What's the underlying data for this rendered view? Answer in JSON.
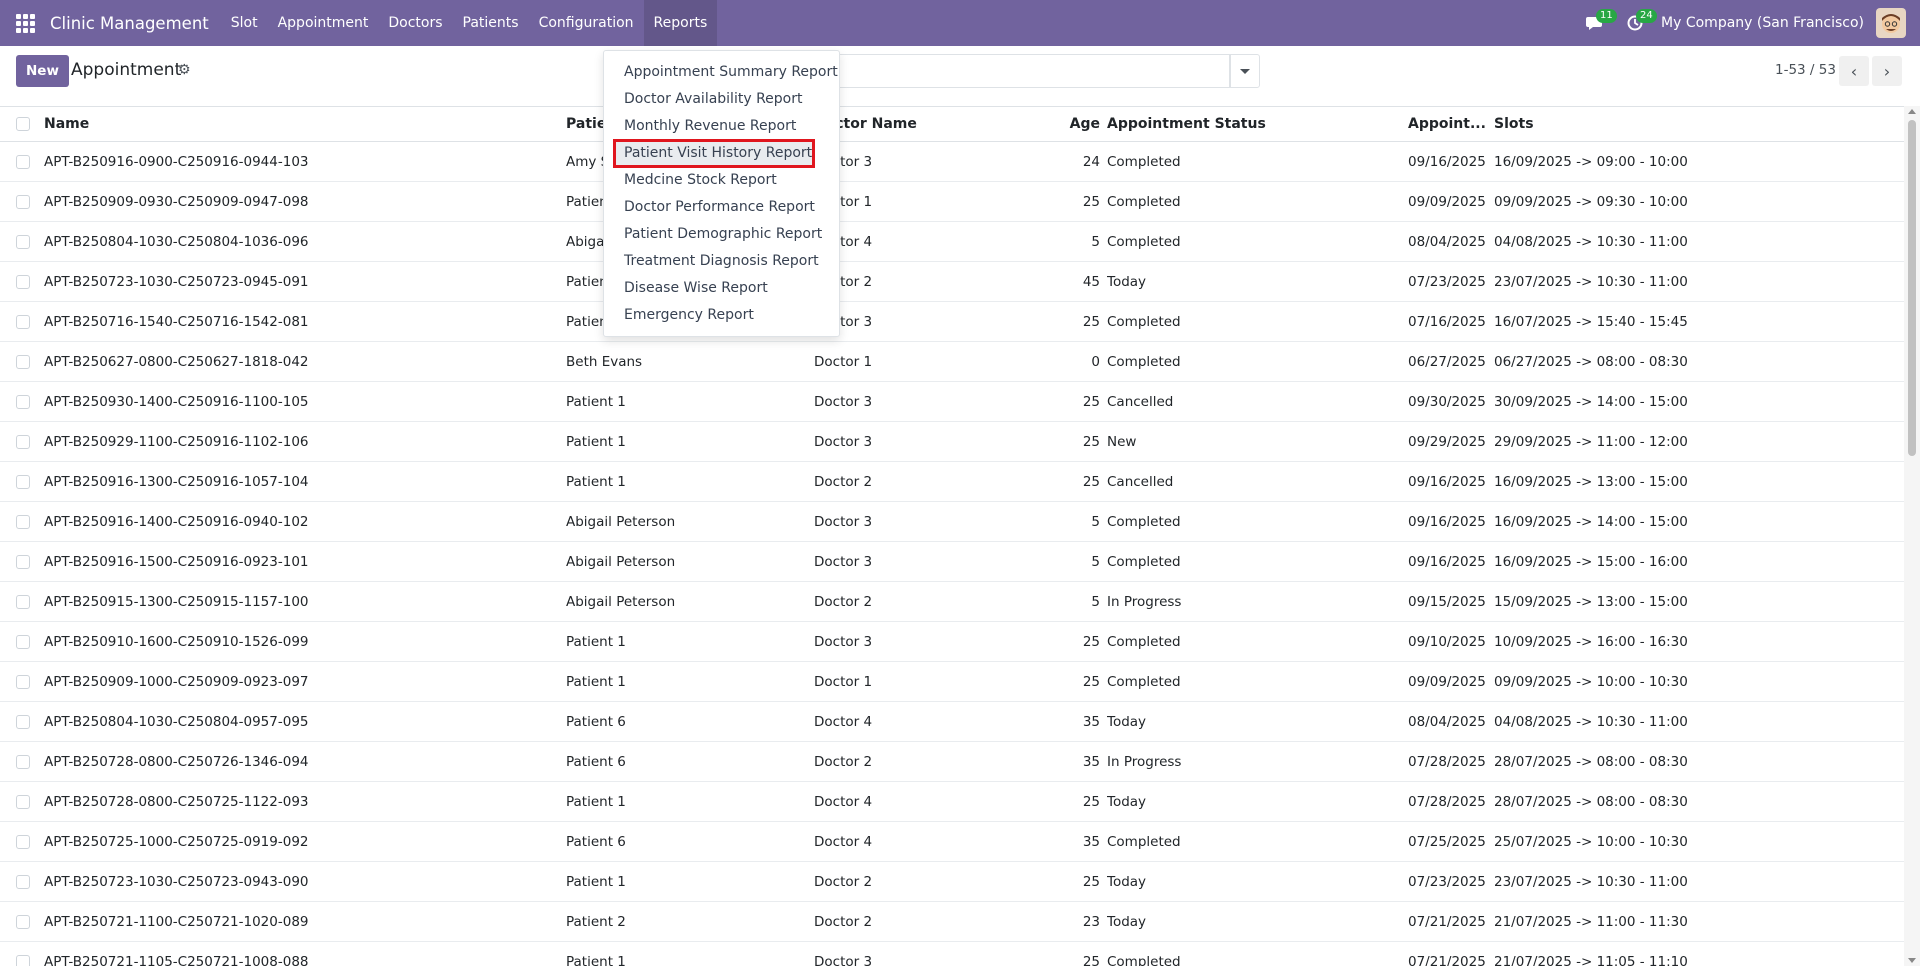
{
  "app": {
    "brand": "Clinic Management",
    "menu": [
      "Slot",
      "Appointment",
      "Doctors",
      "Patients",
      "Configuration",
      "Reports"
    ],
    "active_menu": "Reports",
    "messages_count": "11",
    "activities_count": "24",
    "company": "My Company (San Francisco)"
  },
  "control": {
    "new_label": "New",
    "title": "Appointment",
    "pager": "1-53 / 53"
  },
  "reports_menu": {
    "items": [
      "Appointment Summary Report",
      "Doctor Availability Report",
      "Monthly Revenue Report",
      "Patient Visit History Report",
      "Medcine Stock Report",
      "Doctor Performance Report",
      "Patient Demographic Report",
      "Treatment Diagnosis Report",
      "Disease Wise Report",
      "Emergency Report"
    ],
    "highlighted_index": 3
  },
  "table": {
    "headers": {
      "name": "Name",
      "patient": "Patient Name",
      "doctor": "Doctor Name",
      "age": "Age",
      "status": "Appointment Status",
      "date": "Appoint...",
      "slots": "Slots"
    },
    "rows": [
      {
        "name": "APT-B250916-0900-C250916-0944-103",
        "patient": "Amy Smith",
        "doctor": "Doctor 3",
        "age": "24",
        "status": "Completed",
        "date": "09/16/2025",
        "slots": "16/09/2025 -> 09:00 - 10:00"
      },
      {
        "name": "APT-B250909-0930-C250909-0947-098",
        "patient": "Patient 1",
        "doctor": "Doctor 1",
        "age": "25",
        "status": "Completed",
        "date": "09/09/2025",
        "slots": "09/09/2025 -> 09:30 - 10:00"
      },
      {
        "name": "APT-B250804-1030-C250804-1036-096",
        "patient": "Abigail Peterson",
        "doctor": "Doctor 4",
        "age": "5",
        "status": "Completed",
        "date": "08/04/2025",
        "slots": "04/08/2025 -> 10:30 - 11:00"
      },
      {
        "name": "APT-B250723-1030-C250723-0945-091",
        "patient": "Patient 1",
        "doctor": "Doctor 2",
        "age": "45",
        "status": "Today",
        "date": "07/23/2025",
        "slots": "23/07/2025 -> 10:30 - 11:00"
      },
      {
        "name": "APT-B250716-1540-C250716-1542-081",
        "patient": "Patient 1",
        "doctor": "Doctor 3",
        "age": "25",
        "status": "Completed",
        "date": "07/16/2025",
        "slots": "16/07/2025 -> 15:40 - 15:45"
      },
      {
        "name": "APT-B250627-0800-C250627-1818-042",
        "patient": "Beth Evans",
        "doctor": "Doctor 1",
        "age": "0",
        "status": "Completed",
        "date": "06/27/2025",
        "slots": "06/27/2025 -> 08:00 - 08:30"
      },
      {
        "name": "APT-B250930-1400-C250916-1100-105",
        "patient": "Patient 1",
        "doctor": "Doctor 3",
        "age": "25",
        "status": "Cancelled",
        "date": "09/30/2025",
        "slots": "30/09/2025 -> 14:00 - 15:00"
      },
      {
        "name": "APT-B250929-1100-C250916-1102-106",
        "patient": "Patient 1",
        "doctor": "Doctor 3",
        "age": "25",
        "status": "New",
        "date": "09/29/2025",
        "slots": "29/09/2025 -> 11:00 - 12:00"
      },
      {
        "name": "APT-B250916-1300-C250916-1057-104",
        "patient": "Patient 1",
        "doctor": "Doctor 2",
        "age": "25",
        "status": "Cancelled",
        "date": "09/16/2025",
        "slots": "16/09/2025 -> 13:00 - 15:00"
      },
      {
        "name": "APT-B250916-1400-C250916-0940-102",
        "patient": "Abigail Peterson",
        "doctor": "Doctor 3",
        "age": "5",
        "status": "Completed",
        "date": "09/16/2025",
        "slots": "16/09/2025 -> 14:00 - 15:00"
      },
      {
        "name": "APT-B250916-1500-C250916-0923-101",
        "patient": "Abigail Peterson",
        "doctor": "Doctor 3",
        "age": "5",
        "status": "Completed",
        "date": "09/16/2025",
        "slots": "16/09/2025 -> 15:00 - 16:00"
      },
      {
        "name": "APT-B250915-1300-C250915-1157-100",
        "patient": "Abigail Peterson",
        "doctor": "Doctor 2",
        "age": "5",
        "status": "In Progress",
        "date": "09/15/2025",
        "slots": "15/09/2025 -> 13:00 - 15:00"
      },
      {
        "name": "APT-B250910-1600-C250910-1526-099",
        "patient": "Patient 1",
        "doctor": "Doctor 3",
        "age": "25",
        "status": "Completed",
        "date": "09/10/2025",
        "slots": "10/09/2025 -> 16:00 - 16:30"
      },
      {
        "name": "APT-B250909-1000-C250909-0923-097",
        "patient": "Patient 1",
        "doctor": "Doctor 1",
        "age": "25",
        "status": "Completed",
        "date": "09/09/2025",
        "slots": "09/09/2025 -> 10:00 - 10:30"
      },
      {
        "name": "APT-B250804-1030-C250804-0957-095",
        "patient": "Patient 6",
        "doctor": "Doctor 4",
        "age": "35",
        "status": "Today",
        "date": "08/04/2025",
        "slots": "04/08/2025 -> 10:30 - 11:00"
      },
      {
        "name": "APT-B250728-0800-C250726-1346-094",
        "patient": "Patient 6",
        "doctor": "Doctor 2",
        "age": "35",
        "status": "In Progress",
        "date": "07/28/2025",
        "slots": "28/07/2025 -> 08:00 - 08:30"
      },
      {
        "name": "APT-B250728-0800-C250725-1122-093",
        "patient": "Patient 1",
        "doctor": "Doctor 4",
        "age": "25",
        "status": "Today",
        "date": "07/28/2025",
        "slots": "28/07/2025 -> 08:00 - 08:30"
      },
      {
        "name": "APT-B250725-1000-C250725-0919-092",
        "patient": "Patient 6",
        "doctor": "Doctor 4",
        "age": "35",
        "status": "Completed",
        "date": "07/25/2025",
        "slots": "25/07/2025 -> 10:00 - 10:30"
      },
      {
        "name": "APT-B250723-1030-C250723-0943-090",
        "patient": "Patient 1",
        "doctor": "Doctor 2",
        "age": "25",
        "status": "Today",
        "date": "07/23/2025",
        "slots": "23/07/2025 -> 10:30 - 11:00"
      },
      {
        "name": "APT-B250721-1100-C250721-1020-089",
        "patient": "Patient 2",
        "doctor": "Doctor 2",
        "age": "23",
        "status": "Today",
        "date": "07/21/2025",
        "slots": "21/07/2025 -> 11:00 - 11:30"
      },
      {
        "name": "APT-B250721-1105-C250721-1008-088",
        "patient": "Patient 1",
        "doctor": "Doctor 3",
        "age": "25",
        "status": "Completed",
        "date": "07/21/2025",
        "slots": "21/07/2025 -> 11:05 - 11:10"
      }
    ]
  },
  "colors": {
    "navbar": "#71639e",
    "highlight_border": "#e0161e",
    "badge": "#28a745"
  }
}
